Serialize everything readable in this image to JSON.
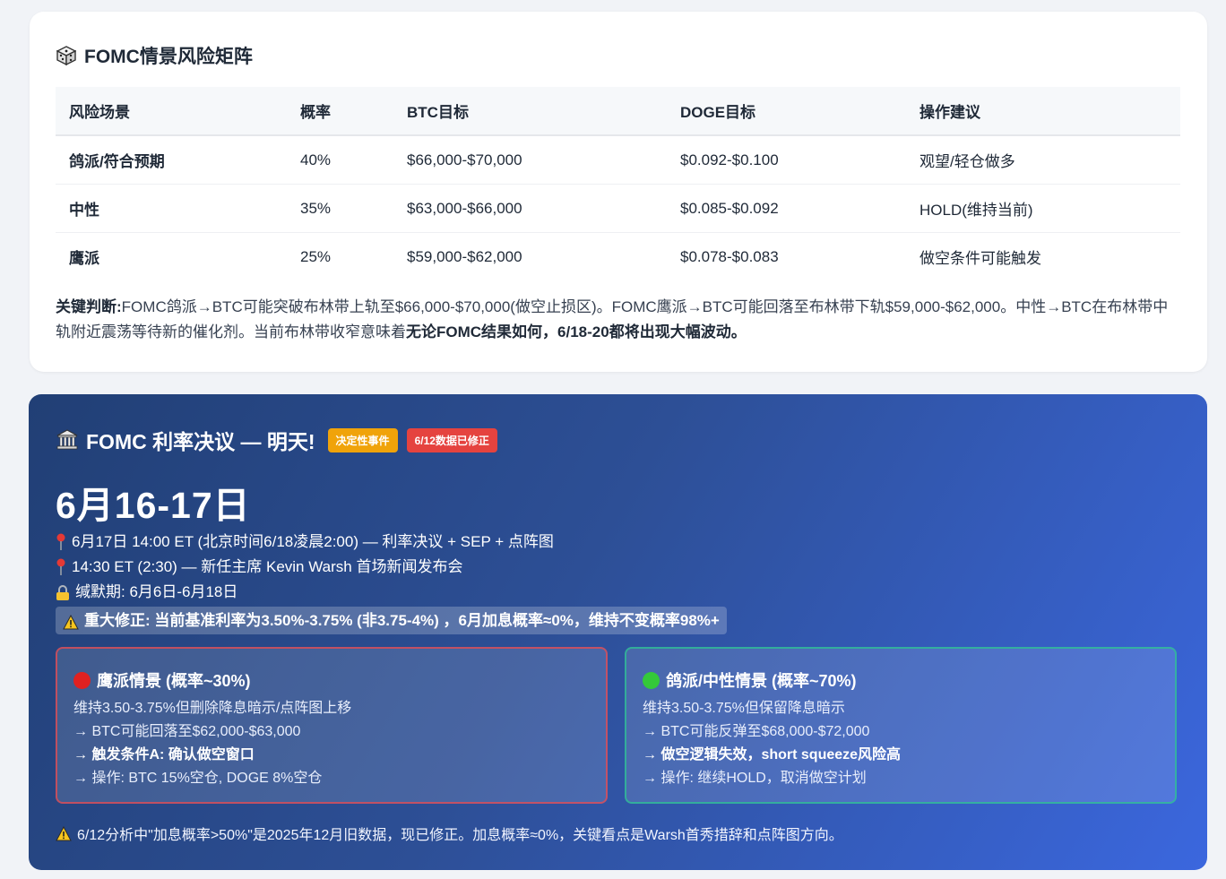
{
  "matrix": {
    "title": "FOMC情景风险矩阵",
    "headers": [
      "风险场景",
      "概率",
      "BTC目标",
      "DOGE目标",
      "操作建议"
    ],
    "rows": [
      {
        "scenario": "鸽派/符合预期",
        "prob": "40%",
        "btc": "$66,000-$70,000",
        "doge": "$0.092-$0.100",
        "advice": "观望/轻仓做多"
      },
      {
        "scenario": "中性",
        "prob": "35%",
        "btc": "$63,000-$66,000",
        "doge": "$0.085-$0.092",
        "advice": "HOLD(维持当前)"
      },
      {
        "scenario": "鹰派",
        "prob": "25%",
        "btc": "$59,000-$62,000",
        "doge": "$0.078-$0.083",
        "advice": "做空条件可能触发"
      }
    ],
    "judgement_label": "关键判断:",
    "judgement_text": "FOMC鸽派→BTC可能突破布林带上轨至$66,000-$70,000(做空止损区)。FOMC鹰派→BTC可能回落至布林带下轨$59,000-$62,000。中性→BTC在布林带中轨附近震荡等待新的催化剂。当前布林带收窄意味着",
    "judgement_emph": "无论FOMC结果如何，6/18-20都将出现大幅波动。",
    "colors": {
      "green": "#22a55a",
      "amber": "#e6950d",
      "red": "#e0413f"
    }
  },
  "fomc": {
    "title": "FOMC 利率决议 — 明天!",
    "badge_decisive": "决定性事件",
    "badge_corrected": "6/12数据已修正",
    "date": "6月16-17日",
    "line1": "6月17日 14:00 ET (北京时间6/18凌晨2:00) — 利率决议 + SEP + 点阵图",
    "line2": "14:30 ET (2:30) — 新任主席 Kevin Warsh 首场新闻发布会",
    "line3": "缄默期: 6月6日-6月18日",
    "warning": "重大修正: 当前基准利率为3.50%-3.75% (非3.75-4%) ，6月加息概率≈0%，维持不变概率98%+",
    "hawk": {
      "title": "鹰派情景 (概率~30%)",
      "l1": "维持3.50-3.75%但删除降息暗示/点阵图上移",
      "l2": "→ BTC可能回落至$62,000-$63,000",
      "l3": "→ 触发条件A: 确认做空窗口",
      "l4": "→ 操作: BTC 15%空仓, DOGE 8%空仓"
    },
    "dove": {
      "title": "鸽派/中性情景 (概率~70%)",
      "l1": "维持3.50-3.75%但保留降息暗示",
      "l2": "→ BTC可能反弹至$68,000-$72,000",
      "l3": "→ 做空逻辑失效，short squeeze风险高",
      "l4": "→ 操作: 继续HOLD，取消做空计划"
    },
    "footnote": "6/12分析中\"加息概率>50%\"是2025年12月旧数据，现已修正。加息概率≈0%，关键看点是Warsh首秀措辞和点阵图方向。"
  }
}
